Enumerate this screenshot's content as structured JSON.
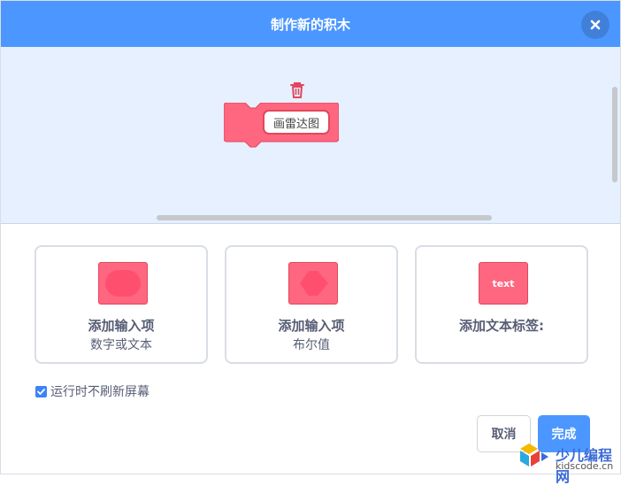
{
  "dialog": {
    "title": "制作新的积木"
  },
  "workspace": {
    "block_label": "画雷达图"
  },
  "options": [
    {
      "title": "添加输入项",
      "subtitle": "数字或文本",
      "icon": "number-text-input-icon"
    },
    {
      "title": "添加输入项",
      "subtitle": "布尔值",
      "icon": "boolean-input-icon"
    },
    {
      "title": "添加文本标签:",
      "subtitle": "",
      "icon_text": "text",
      "icon": "text-label-icon"
    }
  ],
  "checkbox": {
    "label": "运行时不刷新屏幕",
    "checked": true
  },
  "buttons": {
    "cancel": "取消",
    "done": "完成"
  },
  "watermark": {
    "main": "少儿编程网",
    "sub": "kidscode.cn"
  },
  "colors": {
    "header": "#4c97ff",
    "block": "#ff6680",
    "workspace": "#e6f0ff"
  }
}
